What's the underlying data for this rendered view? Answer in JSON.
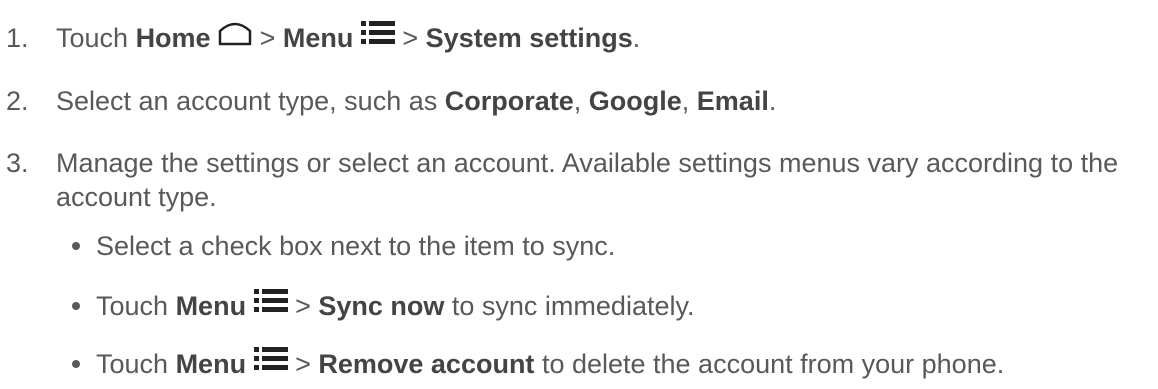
{
  "steps": [
    {
      "number": "1.",
      "parts": {
        "touch": "Touch ",
        "home": "Home",
        "sep1": " > ",
        "menu": "Menu",
        "sep2": " > ",
        "system_settings": "System settings",
        "end": "."
      }
    },
    {
      "number": "2.",
      "parts": {
        "select": "Select an account type, such as ",
        "corporate": "Corporate",
        "comma1": ", ",
        "google": "Google",
        "comma2": ", ",
        "email": "Email",
        "end": "."
      }
    },
    {
      "number": "3.",
      "line1": "Manage the settings or select an account. Available settings menus vary according to the",
      "line2": "account type."
    }
  ],
  "bullets": [
    {
      "text": "Select a check box next to the item to sync."
    },
    {
      "touch": "Touch ",
      "menu": "Menu",
      "sep": " > ",
      "action": "Sync now",
      "rest": " to sync immediately."
    },
    {
      "touch": "Touch ",
      "menu": "Menu",
      "sep": " > ",
      "action": "Remove account",
      "rest": " to delete the account from your phone."
    }
  ],
  "icons": {
    "home": "home-icon",
    "menu": "menu-icon"
  },
  "colors": {
    "text": "#595959",
    "bold": "#444444",
    "icon": "#222222"
  }
}
